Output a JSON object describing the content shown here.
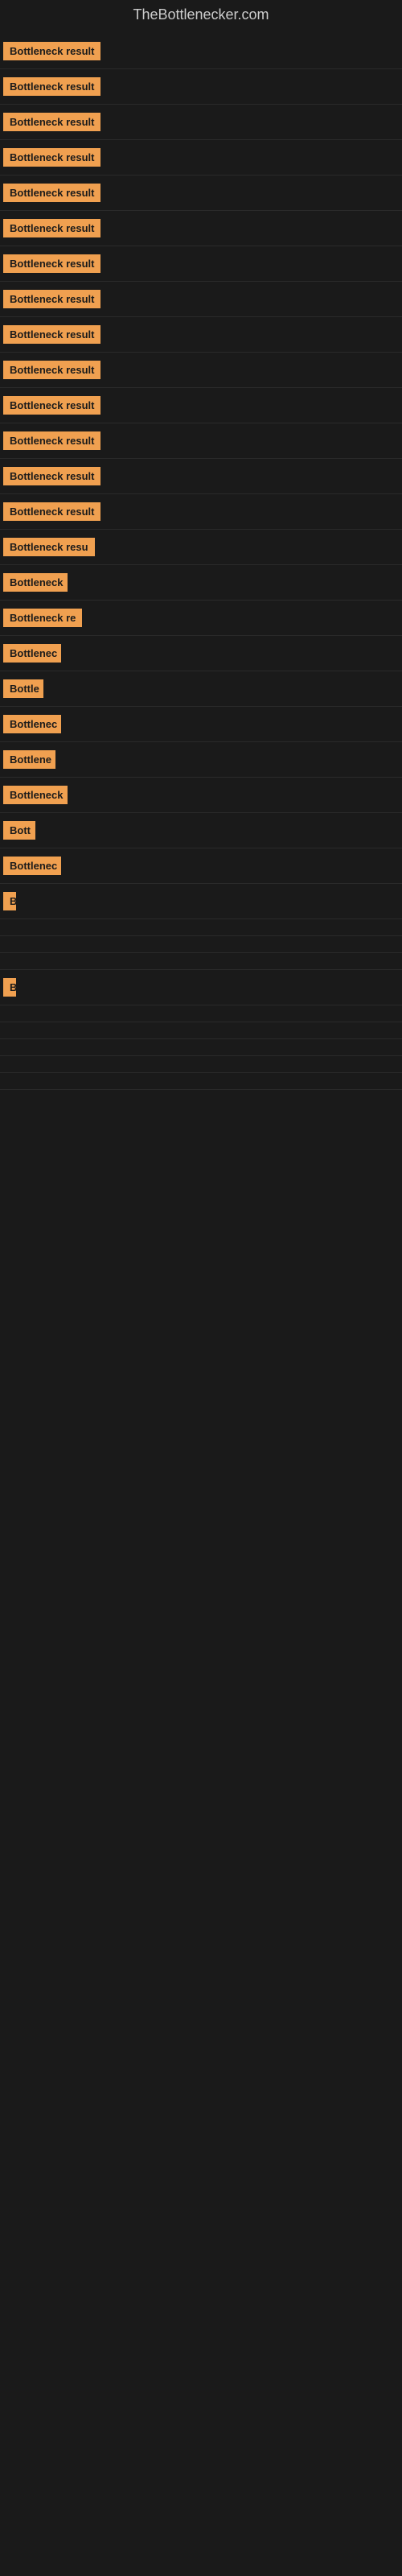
{
  "header": {
    "title": "TheBottlenecker.com"
  },
  "items": [
    {
      "label": "Bottleneck result",
      "width": 130
    },
    {
      "label": "Bottleneck result",
      "width": 130
    },
    {
      "label": "Bottleneck result",
      "width": 130
    },
    {
      "label": "Bottleneck result",
      "width": 130
    },
    {
      "label": "Bottleneck result",
      "width": 130
    },
    {
      "label": "Bottleneck result",
      "width": 130
    },
    {
      "label": "Bottleneck result",
      "width": 130
    },
    {
      "label": "Bottleneck result",
      "width": 130
    },
    {
      "label": "Bottleneck result",
      "width": 130
    },
    {
      "label": "Bottleneck result",
      "width": 130
    },
    {
      "label": "Bottleneck result",
      "width": 130
    },
    {
      "label": "Bottleneck result",
      "width": 130
    },
    {
      "label": "Bottleneck result",
      "width": 130
    },
    {
      "label": "Bottleneck result",
      "width": 130
    },
    {
      "label": "Bottleneck resu",
      "width": 115
    },
    {
      "label": "Bottleneck",
      "width": 80
    },
    {
      "label": "Bottleneck re",
      "width": 100
    },
    {
      "label": "Bottlenec",
      "width": 72
    },
    {
      "label": "Bottle",
      "width": 50
    },
    {
      "label": "Bottlenec",
      "width": 72
    },
    {
      "label": "Bottlene",
      "width": 65
    },
    {
      "label": "Bottleneck",
      "width": 80
    },
    {
      "label": "Bott",
      "width": 40
    },
    {
      "label": "Bottlenec",
      "width": 72
    },
    {
      "label": "B",
      "width": 16
    },
    {
      "label": "",
      "width": 0
    },
    {
      "label": "",
      "width": 0
    },
    {
      "label": "",
      "width": 0
    },
    {
      "label": "B",
      "width": 16
    },
    {
      "label": "",
      "width": 0
    },
    {
      "label": "",
      "width": 0
    },
    {
      "label": "",
      "width": 0
    },
    {
      "label": "",
      "width": 0
    },
    {
      "label": "",
      "width": 0
    }
  ]
}
